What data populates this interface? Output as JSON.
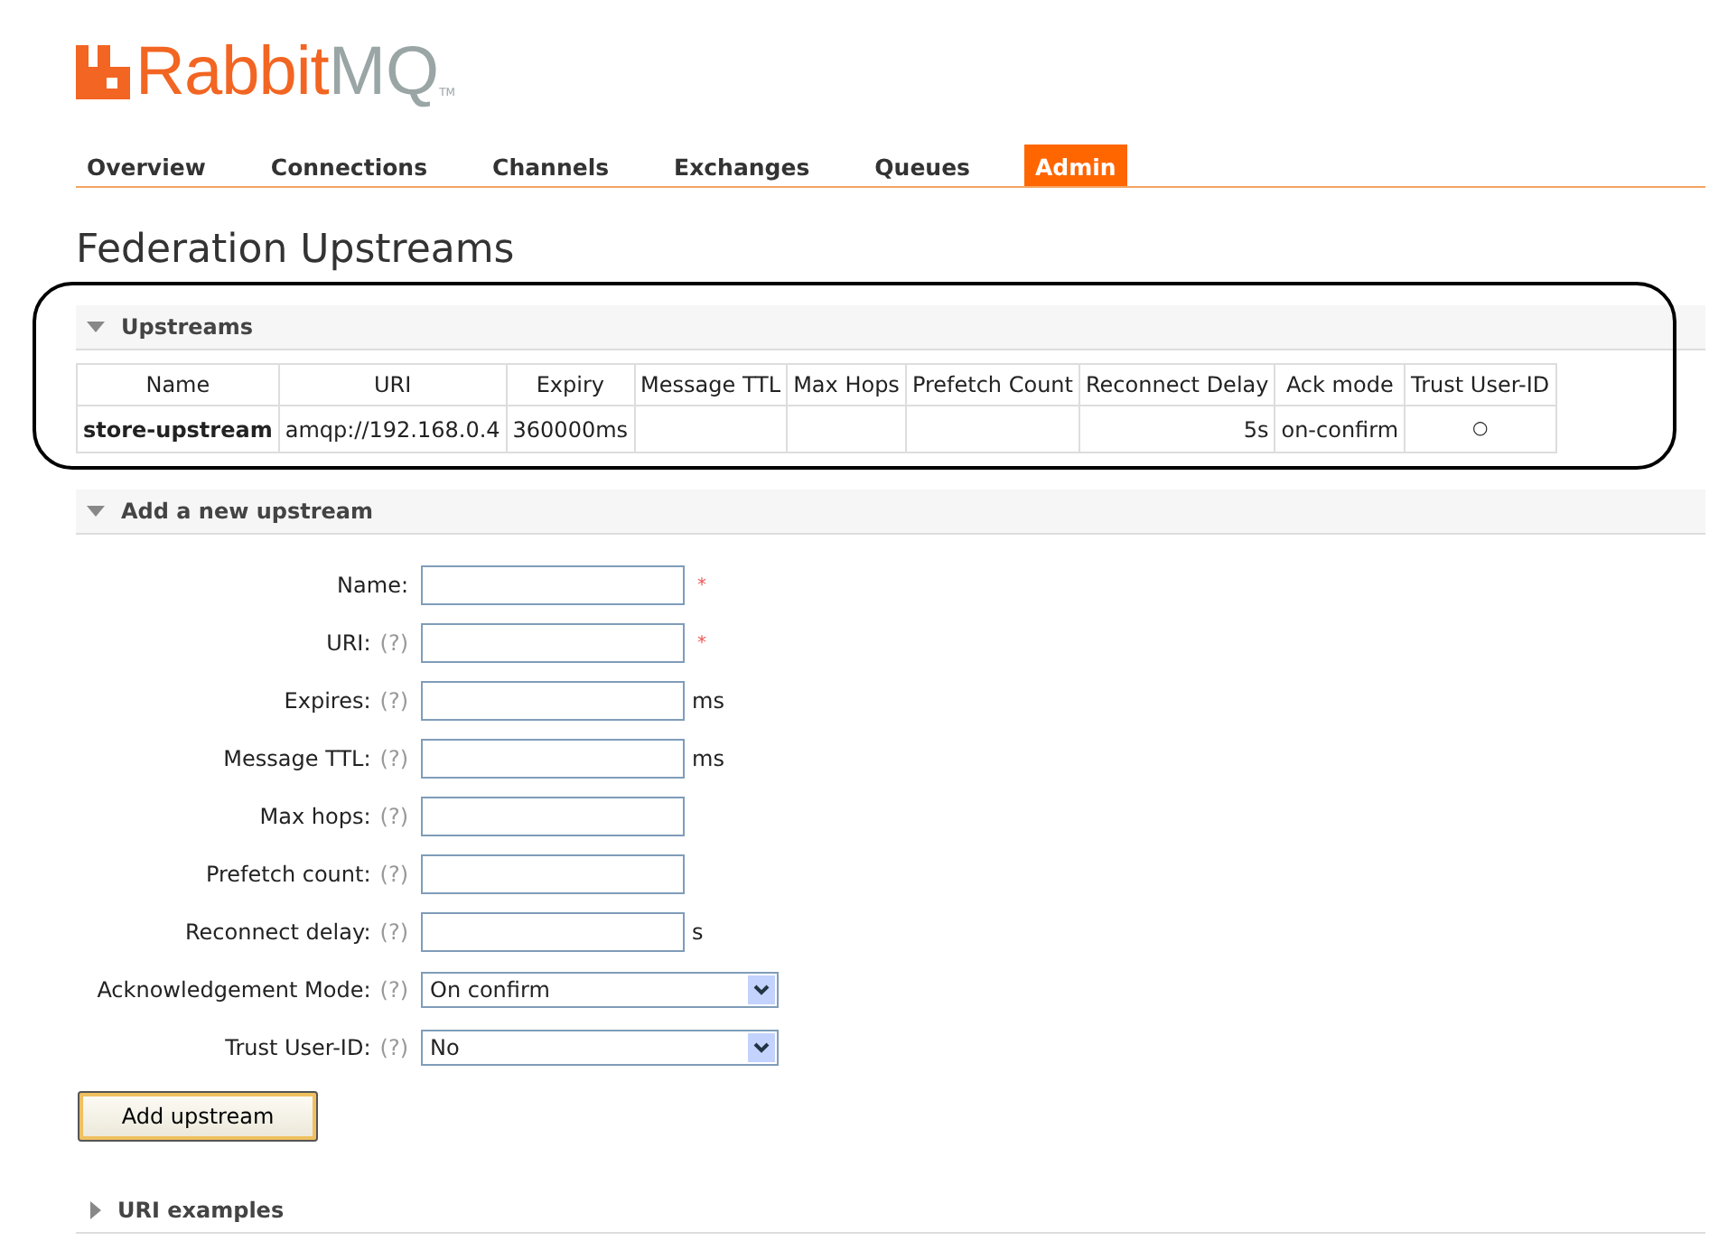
{
  "logo": {
    "primary": "Rabbit",
    "secondary": "MQ",
    "trademark": "TM"
  },
  "nav": [
    {
      "label": "Overview",
      "selected": false
    },
    {
      "label": "Connections",
      "selected": false
    },
    {
      "label": "Channels",
      "selected": false
    },
    {
      "label": "Exchanges",
      "selected": false
    },
    {
      "label": "Queues",
      "selected": false
    },
    {
      "label": "Admin",
      "selected": true
    }
  ],
  "page_title": "Federation Upstreams",
  "upstreams_section": {
    "title": "Upstreams",
    "expanded": true,
    "annotated": true,
    "table": {
      "columns": [
        "Name",
        "URI",
        "Expiry",
        "Message TTL",
        "Max Hops",
        "Prefetch Count",
        "Reconnect Delay",
        "Ack mode",
        "Trust User-ID"
      ],
      "rows": [
        [
          "store-upstream",
          "amqp://192.168.0.4",
          "360000ms",
          "",
          "",
          "",
          "5s",
          "on-confirm",
          "○"
        ]
      ]
    }
  },
  "add_section": {
    "title": "Add a new upstream",
    "expanded": true,
    "fields": [
      {
        "kind": "text",
        "label": "Name:",
        "required": true
      },
      {
        "kind": "text",
        "label": "URI:",
        "help": "(?)",
        "required": true
      },
      {
        "kind": "text",
        "label": "Expires:",
        "help": "(?)",
        "unit": "ms"
      },
      {
        "kind": "text",
        "label": "Message TTL:",
        "help": "(?)",
        "unit": "ms"
      },
      {
        "kind": "text",
        "label": "Max hops:",
        "help": "(?)"
      },
      {
        "kind": "text",
        "label": "Prefetch count:",
        "help": "(?)"
      },
      {
        "kind": "text",
        "label": "Reconnect delay:",
        "help": "(?)",
        "unit": "s"
      },
      {
        "kind": "select",
        "label": "Acknowledgement Mode:",
        "help": "(?)",
        "value": "On confirm"
      },
      {
        "kind": "select",
        "label": "Trust User-ID:",
        "help": "(?)",
        "value": "No"
      }
    ],
    "required_mark": "*",
    "submit": "Add upstream"
  },
  "examples_section": {
    "title": "URI examples",
    "expanded": false
  }
}
